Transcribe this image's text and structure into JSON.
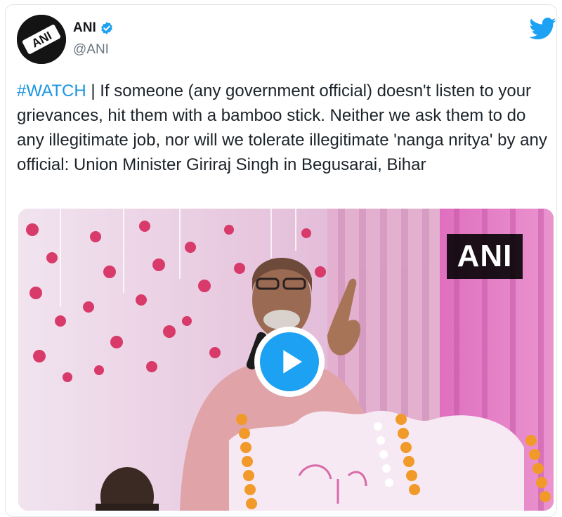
{
  "account": {
    "display_name": "ANI",
    "handle": "@ANI",
    "avatar_text": "ANI"
  },
  "tweet": {
    "hashtag": "#WATCH",
    "separator": " | ",
    "text": "If someone (any government official) doesn't listen to your grievances, hit them with a bamboo stick. Neither we ask them to do any illegitimate job, nor will we tolerate illegitimate 'nanga nritya' by any official: Union Minister Giriraj Singh in Begusarai, Bihar"
  },
  "media": {
    "watermark": "ANI",
    "play_icon": "play-icon"
  },
  "icons": {
    "verified": "verified-badge-icon",
    "brand": "twitter-bird-icon"
  },
  "colors": {
    "accent": "#1da1f2",
    "hashtag": "#1b95e0",
    "muted": "#6a7682",
    "text": "#1c2329"
  }
}
